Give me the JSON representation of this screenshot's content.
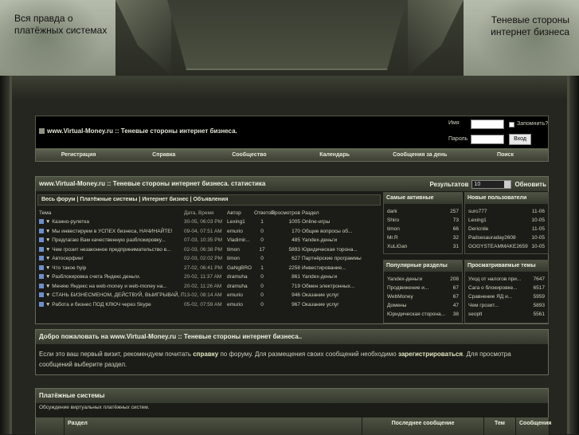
{
  "header": {
    "left_line1": "Вся правда о",
    "left_line2": "платёжных системах",
    "right_line1": "Теневые стороны",
    "right_line2": "интернет бизнеса"
  },
  "site_title": "www.Virtual-Money.ru :: Теневые стороны интернет бизнеса.",
  "login": {
    "name_label": "Имя",
    "password_label": "Пароль",
    "remember_label": "Запомнить?",
    "login_button": "Вход"
  },
  "nav": [
    "Регистрация",
    "Справка",
    "Сообщество",
    "Календарь",
    "Сообщения за день",
    "Поиск"
  ],
  "stats": {
    "title": "www.Virtual-Money.ru :: Теневые стороны интернет бизнеса. статистика",
    "results_label": "Результатов",
    "results_value": "10",
    "refresh_label": "Обновить",
    "tabs": "Весь форум   | Платёжные системы | Интернет бизнес | Объявления",
    "columns": [
      "Тема",
      "Дата, Время",
      "Автор",
      "Ответов",
      "Просмотров",
      "Раздел"
    ],
    "rows": [
      [
        "▼ Казино-рулетка",
        "30-05, 06:03 PM",
        "Lexing1",
        "1",
        "1005",
        "Online-игры"
      ],
      [
        "▼ Мы инвестируем в УСПЕХ бизнеса, НАЧИНАЙТЕ!",
        "09-04, 07:51 AM",
        "emurio",
        "0",
        "170",
        "Общие вопросы об..."
      ],
      [
        "▼ Предлагаю Вам качественную разблокировку...",
        "07-03, 10:35 PM",
        "Vladimir...",
        "0",
        "485",
        "Yandex-деньги"
      ],
      [
        "▼ Чем грозит незаконное предпринимательство в...",
        "02-03, 06:38 PM",
        "timon",
        "17",
        "5893",
        "Юридическая торона..."
      ],
      [
        "▼ Автосерфинг",
        "02-03, 02:02 PM",
        "timon",
        "0",
        "627",
        "Партнёрские программы"
      ],
      [
        "▼ Что такое hyip",
        "27-02, 06:41 PM",
        "GaNgBRO",
        "1",
        "2258",
        "Инвестирование..."
      ],
      [
        "▼ Разблокировка счета Яндекс.деньги.",
        "20-02, 11:37 AM",
        "dramuha",
        "0",
        "861",
        "Yandex-деньги"
      ],
      [
        "▼ Меняю Яндекс на web-money и web-money на...",
        "20-02, 11:26 AM",
        "dramuha",
        "0",
        "719",
        "Обмен электронных..."
      ],
      [
        "▼ СТАНЬ БИЗНЕСМЕНОМ, ДЕЙСТВУЙ, ВЫИГРЫВАЙ, ПО...",
        "13-02, 08:14 AM",
        "emurio",
        "0",
        "946",
        "Оказание услуг"
      ],
      [
        "▼ Работа и бизнес ПОД КЛЮЧ через Skype",
        "05-02, 07:59 AM",
        "emurio",
        "0",
        "967",
        "Оказание услуг"
      ]
    ],
    "active": {
      "title": "Самые активные",
      "rows": [
        [
          "dark",
          "257"
        ],
        [
          "Shiro",
          "73"
        ],
        [
          "timon",
          "66"
        ],
        [
          "Mr.R",
          "32"
        ],
        [
          "XuLiGan",
          "31"
        ]
      ]
    },
    "new_users": {
      "title": "Новые пользователи",
      "rows": [
        [
          "suro777",
          "11-06"
        ],
        [
          "Lexing1",
          "10-05"
        ],
        [
          "Dericnile",
          "11-05"
        ],
        [
          "Padsesauraday2608",
          "10-05"
        ],
        [
          "GOGYSTEAMMAKE2659",
          "10-05"
        ]
      ]
    },
    "popular": {
      "title": "Популярные разделы",
      "rows": [
        [
          "Yandex-деньги",
          "208"
        ],
        [
          "Продвижение и...",
          "67"
        ],
        [
          "WebMoney",
          "67"
        ],
        [
          "Домены",
          "47"
        ],
        [
          "Юридическая сторона...",
          "38"
        ]
      ]
    },
    "viewed": {
      "title": "Просматриваемые темы",
      "rows": [
        [
          "Уход от налогов при...",
          "7647"
        ],
        [
          "Сага о блокировке...",
          "6517"
        ],
        [
          "Сравнение ЯД и...",
          "5959"
        ],
        [
          "Чем грозит...",
          "5893"
        ],
        [
          "seoplt",
          "5561"
        ]
      ]
    }
  },
  "welcome": {
    "title": "Добро пожаловать на www.Virtual-Money.ru :: Теневые стороны интернет бизнеса..",
    "t1": "Если это ваш первый визит, рекомендуем почитать ",
    "link1": "справку",
    "t2": " по форуму. Для размещения своих сообщений необходимо ",
    "link2": "зарегистрироваться",
    "t3": ". Для просмотра сообщений выберите раздел."
  },
  "forums": {
    "title": "Платёжные системы",
    "subtitle": "Обсуждение виртуальных платёжных систем.",
    "cols": [
      "Раздел",
      "Последнее сообщение",
      "Тем",
      "Сообщения"
    ]
  }
}
